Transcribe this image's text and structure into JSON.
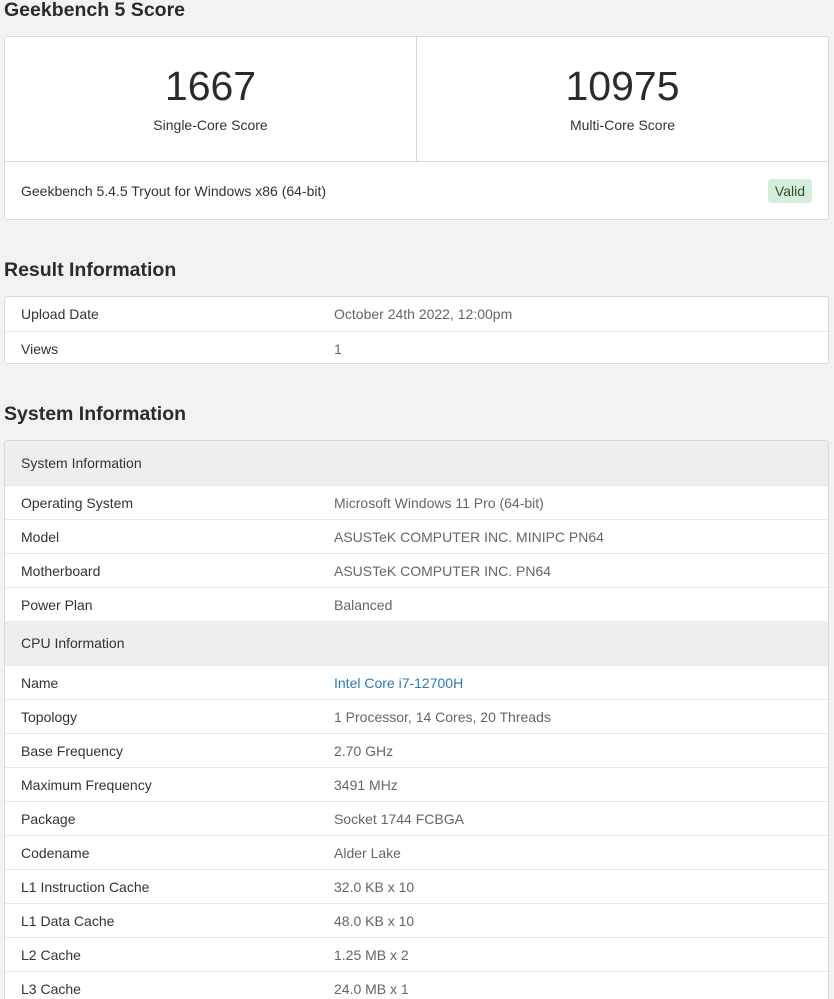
{
  "score_section": {
    "title": "Geekbench 5 Score",
    "single": {
      "value": "1667",
      "label": "Single-Core Score"
    },
    "multi": {
      "value": "10975",
      "label": "Multi-Core Score"
    },
    "version": "Geekbench 5.4.5 Tryout for Windows x86 (64-bit)",
    "status": "Valid"
  },
  "result_section": {
    "title": "Result Information",
    "rows": [
      {
        "key": "Upload Date",
        "value": "October 24th 2022, 12:00pm"
      },
      {
        "key": "Views",
        "value": "1"
      }
    ]
  },
  "system_section": {
    "title": "System Information",
    "groups": [
      {
        "header": "System Information",
        "rows": [
          {
            "key": "Operating System",
            "value": "Microsoft Windows 11 Pro (64-bit)"
          },
          {
            "key": "Model",
            "value": "ASUSTeK COMPUTER INC. MINIPC PN64"
          },
          {
            "key": "Motherboard",
            "value": "ASUSTeK COMPUTER INC. PN64"
          },
          {
            "key": "Power Plan",
            "value": "Balanced"
          }
        ]
      },
      {
        "header": "CPU Information",
        "rows": [
          {
            "key": "Name",
            "value": "Intel Core i7-12700H",
            "link": true
          },
          {
            "key": "Topology",
            "value": "1 Processor, 14 Cores, 20 Threads"
          },
          {
            "key": "Base Frequency",
            "value": "2.70 GHz"
          },
          {
            "key": "Maximum Frequency",
            "value": "3491 MHz"
          },
          {
            "key": "Package",
            "value": "Socket 1744 FCBGA"
          },
          {
            "key": "Codename",
            "value": "Alder Lake"
          },
          {
            "key": "L1 Instruction Cache",
            "value": "32.0 KB x 10"
          },
          {
            "key": "L1 Data Cache",
            "value": "48.0 KB x 10"
          },
          {
            "key": "L2 Cache",
            "value": "1.25 MB x 2"
          },
          {
            "key": "L3 Cache",
            "value": "24.0 MB x 1"
          }
        ]
      }
    ]
  },
  "colors": {
    "page_bg": "#f2f2f2",
    "card_bg": "#ffffff",
    "group_header_bg": "#eeeeee",
    "valid_badge_bg": "#d5eddb",
    "link": "#2a7ab8"
  }
}
